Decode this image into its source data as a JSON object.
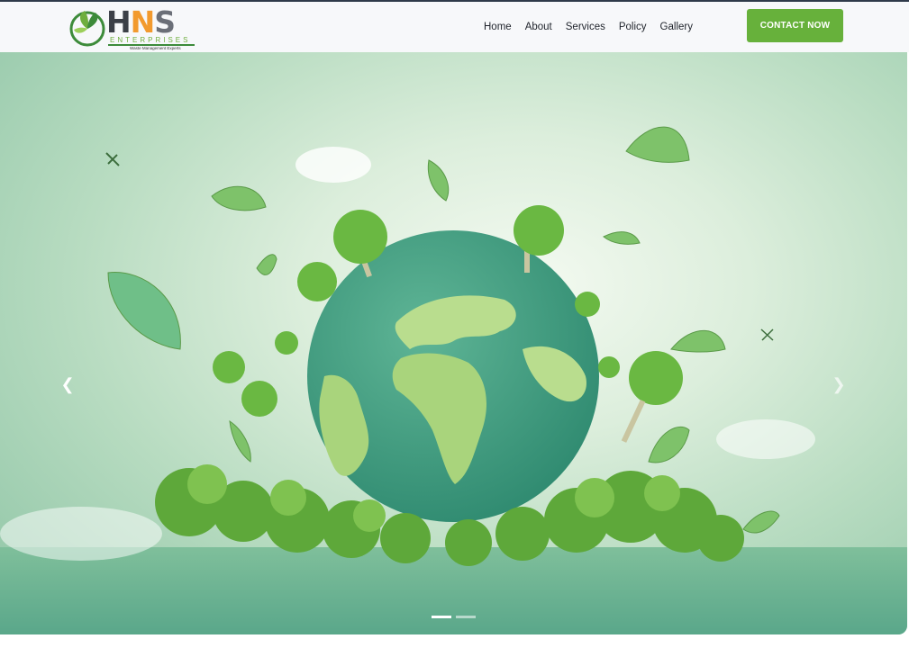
{
  "brand": {
    "letter_h": "H",
    "letter_n": "N",
    "letter_s": "S",
    "subtitle": "ENTERPRISES",
    "tagline": "Waste Management Experts",
    "colors": {
      "dark": "#3b3f47",
      "orange": "#f29a2e",
      "green": "#6fae3e"
    }
  },
  "nav": {
    "items": [
      {
        "label": "Home"
      },
      {
        "label": "About"
      },
      {
        "label": "Services"
      },
      {
        "label": "Policy"
      },
      {
        "label": "Gallery"
      }
    ]
  },
  "cta": {
    "label": "CONTACT NOW",
    "color": "#67b13b"
  },
  "hero": {
    "image": "green-earth-globe-with-trees-illustration",
    "prev_icon": "chevron-left-icon",
    "next_icon": "chevron-right-icon",
    "prev_glyph": "❮",
    "next_glyph": "❯",
    "slides": 2,
    "active_slide": 1
  }
}
